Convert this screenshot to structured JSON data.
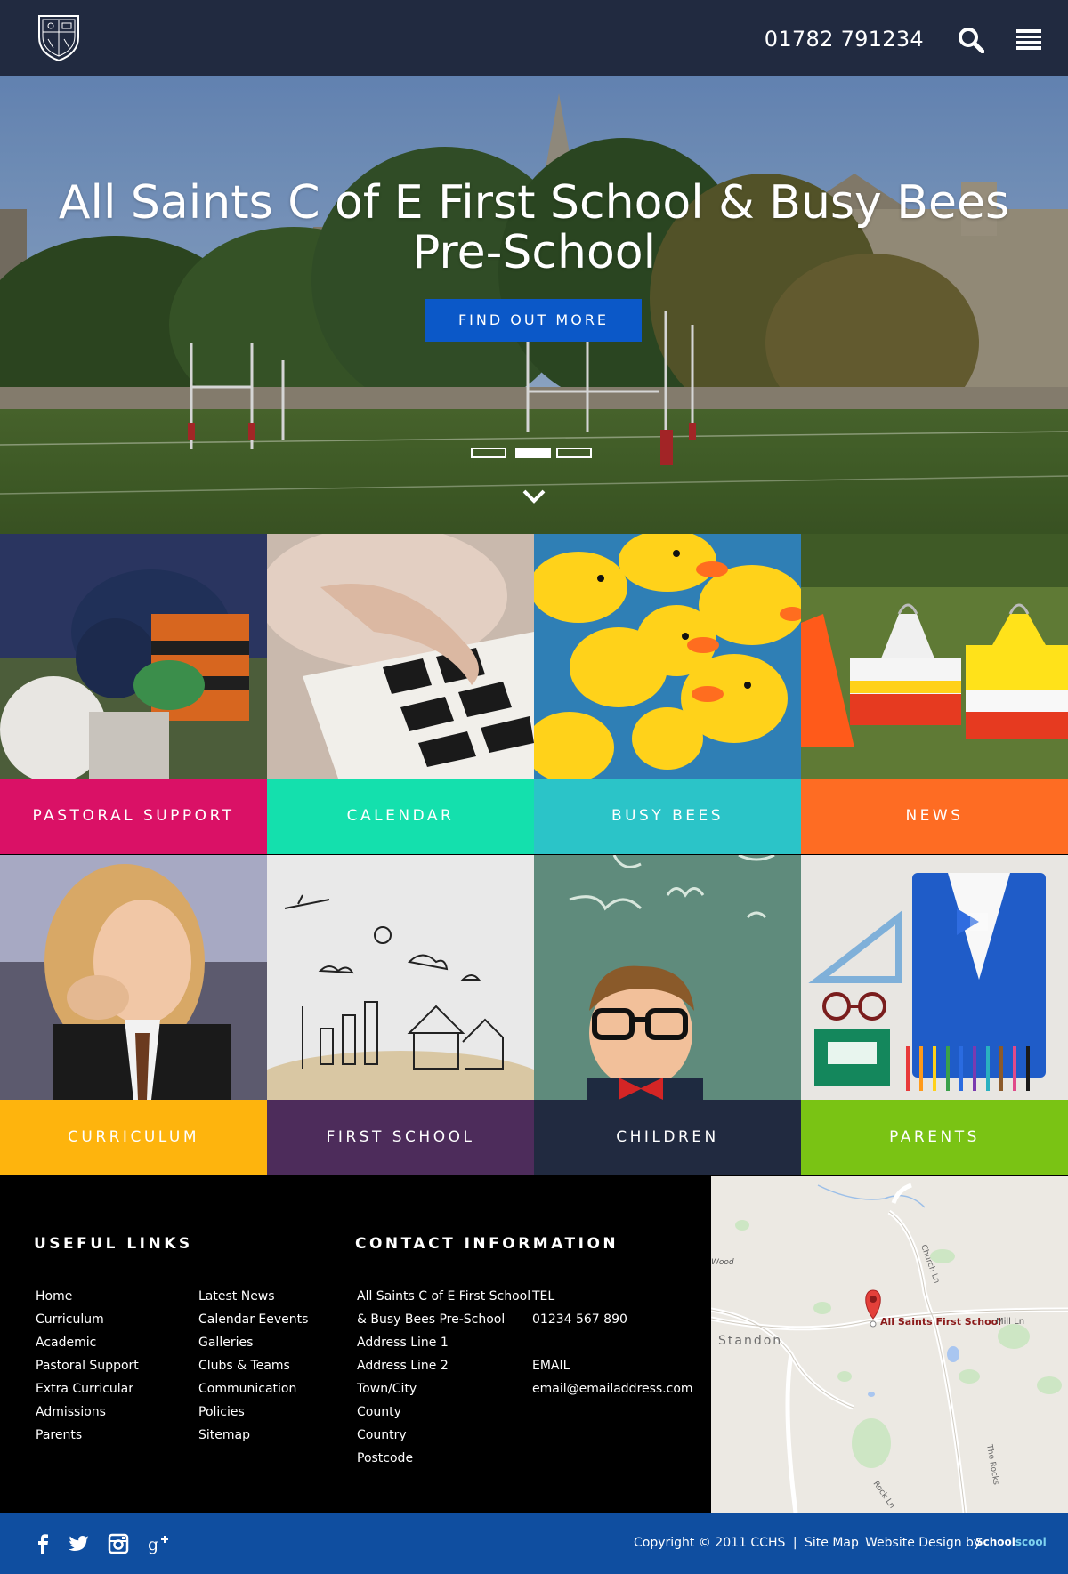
{
  "header": {
    "phone": "01782 791234"
  },
  "hero": {
    "title": "All Saints C of E First School & Busy Bees Pre-School",
    "cta": "FIND OUT MORE",
    "slide_count": 3,
    "active_slide": 2
  },
  "tiles": [
    {
      "label": "PASTORAL SUPPORT",
      "color": "#da1166"
    },
    {
      "label": "CALENDAR",
      "color": "#14e0ad"
    },
    {
      "label": "BUSY BEES",
      "color": "#2bc4c8"
    },
    {
      "label": "NEWS",
      "color": "#fe6c23"
    },
    {
      "label": "CURRICULUM",
      "color": "#feb40d"
    },
    {
      "label": "FIRST SCHOOL",
      "color": "#4d2c5b"
    },
    {
      "label": "CHILDREN",
      "color": "#212a40"
    },
    {
      "label": "PARENTS",
      "color": "#7ac314"
    }
  ],
  "footer": {
    "useful_links_heading": "USEFUL LINKS",
    "links_col1": [
      "Home",
      "Curriculum",
      "Academic",
      "Pastoral Support",
      "Extra Curricular",
      "Admissions",
      "Parents"
    ],
    "links_col2": [
      "Latest News",
      "Calendar Eevents",
      "Galleries",
      "Clubs & Teams",
      "Communication",
      "Policies",
      "Sitemap"
    ],
    "contact_heading": "CONTACT INFORMATION",
    "address": [
      "All Saints C of E First School",
      "& Busy Bees Pre-School",
      "Address Line 1",
      "Address Line 2",
      "Town/City",
      "County",
      "Country",
      "Postcode"
    ],
    "tel_label": "TEL",
    "tel": "01234 567 890",
    "email_label": "EMAIL",
    "email": "email@emailaddress.com"
  },
  "map": {
    "marker_label": "All Saints First School",
    "place_standon": "Standon",
    "place_wood": "Wood",
    "road_mill": "Mill Ln",
    "road_church": "Church Ln",
    "road_rocks": "The Rocks",
    "road_rock": "Rock Ln"
  },
  "bottom": {
    "copyright": "Copyright © 2011 CCHS",
    "separator": "|",
    "sitemap": "Site Map",
    "design_label": "Website Design by",
    "brand_a": "School",
    "brand_b": "scool",
    "social": [
      "facebook-icon",
      "twitter-icon",
      "instagram-icon",
      "google-plus-icon"
    ]
  }
}
